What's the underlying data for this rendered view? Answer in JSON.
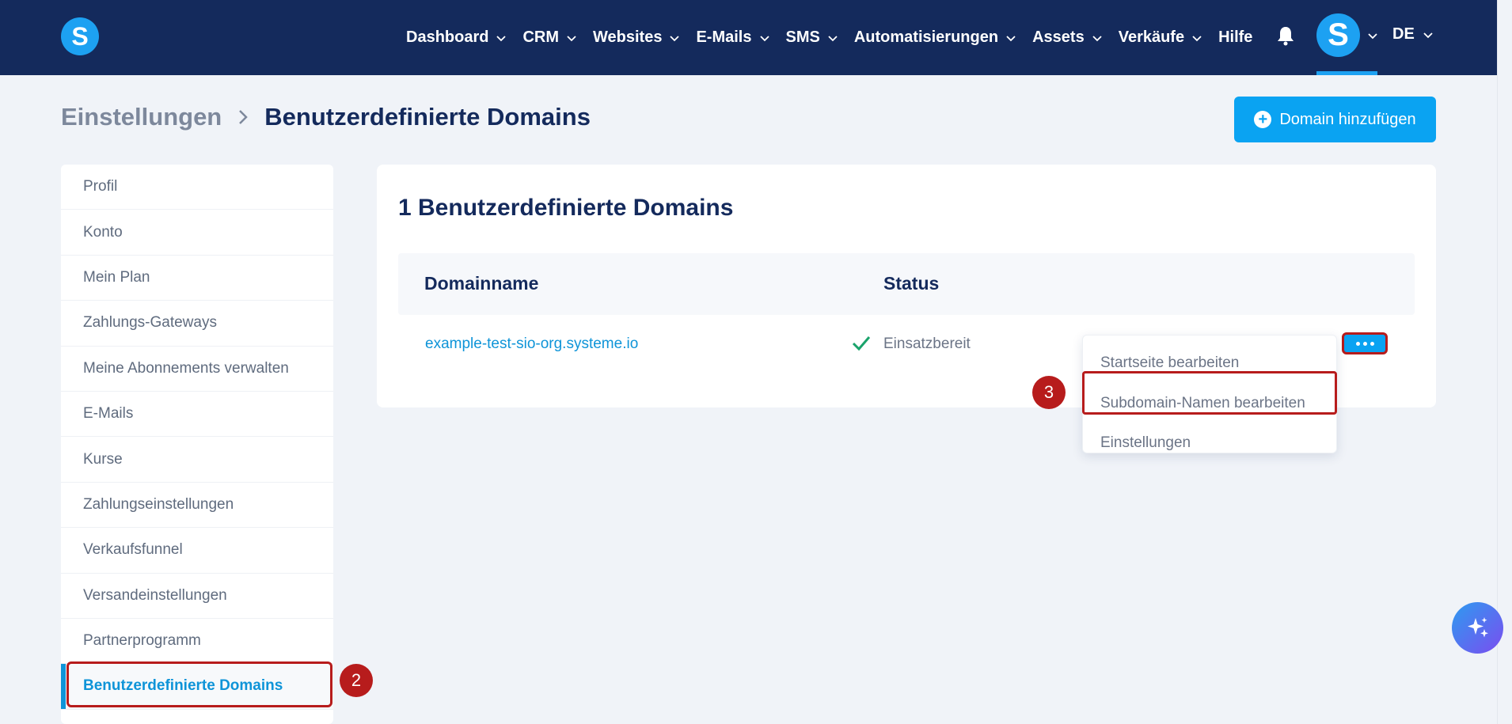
{
  "nav": {
    "items": [
      {
        "label": "Dashboard",
        "has_dropdown": true
      },
      {
        "label": "CRM",
        "has_dropdown": true
      },
      {
        "label": "Websites",
        "has_dropdown": true
      },
      {
        "label": "E-Mails",
        "has_dropdown": true
      },
      {
        "label": "SMS",
        "has_dropdown": true
      },
      {
        "label": "Automatisierungen",
        "has_dropdown": true
      },
      {
        "label": "Assets",
        "has_dropdown": true
      },
      {
        "label": "Verkäufe",
        "has_dropdown": true
      },
      {
        "label": "Hilfe",
        "has_dropdown": false
      }
    ],
    "logo_letter": "S",
    "avatar_letter": "S",
    "language": "DE",
    "icons": {
      "notifications": "bell-icon"
    }
  },
  "breadcrumb": {
    "parent": "Einstellungen",
    "current": "Benutzerdefinierte Domains"
  },
  "add_domain_button": {
    "label": "Domain hinzufügen",
    "icon": "plus-circle-icon"
  },
  "sidebar": {
    "items": [
      {
        "label": "Profil"
      },
      {
        "label": "Konto"
      },
      {
        "label": "Mein Plan"
      },
      {
        "label": "Zahlungs-Gateways"
      },
      {
        "label": "Meine Abonnements verwalten"
      },
      {
        "label": "E-Mails"
      },
      {
        "label": "Kurse"
      },
      {
        "label": "Zahlungseinstellungen"
      },
      {
        "label": "Verkaufsfunnel"
      },
      {
        "label": "Versandeinstellungen"
      },
      {
        "label": "Partnerprogramm"
      },
      {
        "label": "Benutzerdefinierte Domains",
        "active": true
      }
    ]
  },
  "main": {
    "title": "1 Benutzerdefinierte Domains",
    "table": {
      "headers": {
        "domain": "Domainname",
        "status": "Status"
      },
      "rows": [
        {
          "domain": "example-test-sio-org.systeme.io",
          "status": "Einsatzbereit",
          "status_icon": "check-icon"
        }
      ]
    }
  },
  "dropdown": {
    "items": [
      {
        "label": "Startseite bearbeiten"
      },
      {
        "label": "Subdomain-Namen bearbeiten",
        "highlighted": true
      },
      {
        "label": "Einstellungen"
      }
    ]
  },
  "steps": {
    "sidebar": "2",
    "dropdown": "3"
  },
  "colors": {
    "topbar": "#142a5c",
    "accent": "#0aa3f2",
    "highlight": "#b71c1c",
    "success": "#1aa36b"
  }
}
